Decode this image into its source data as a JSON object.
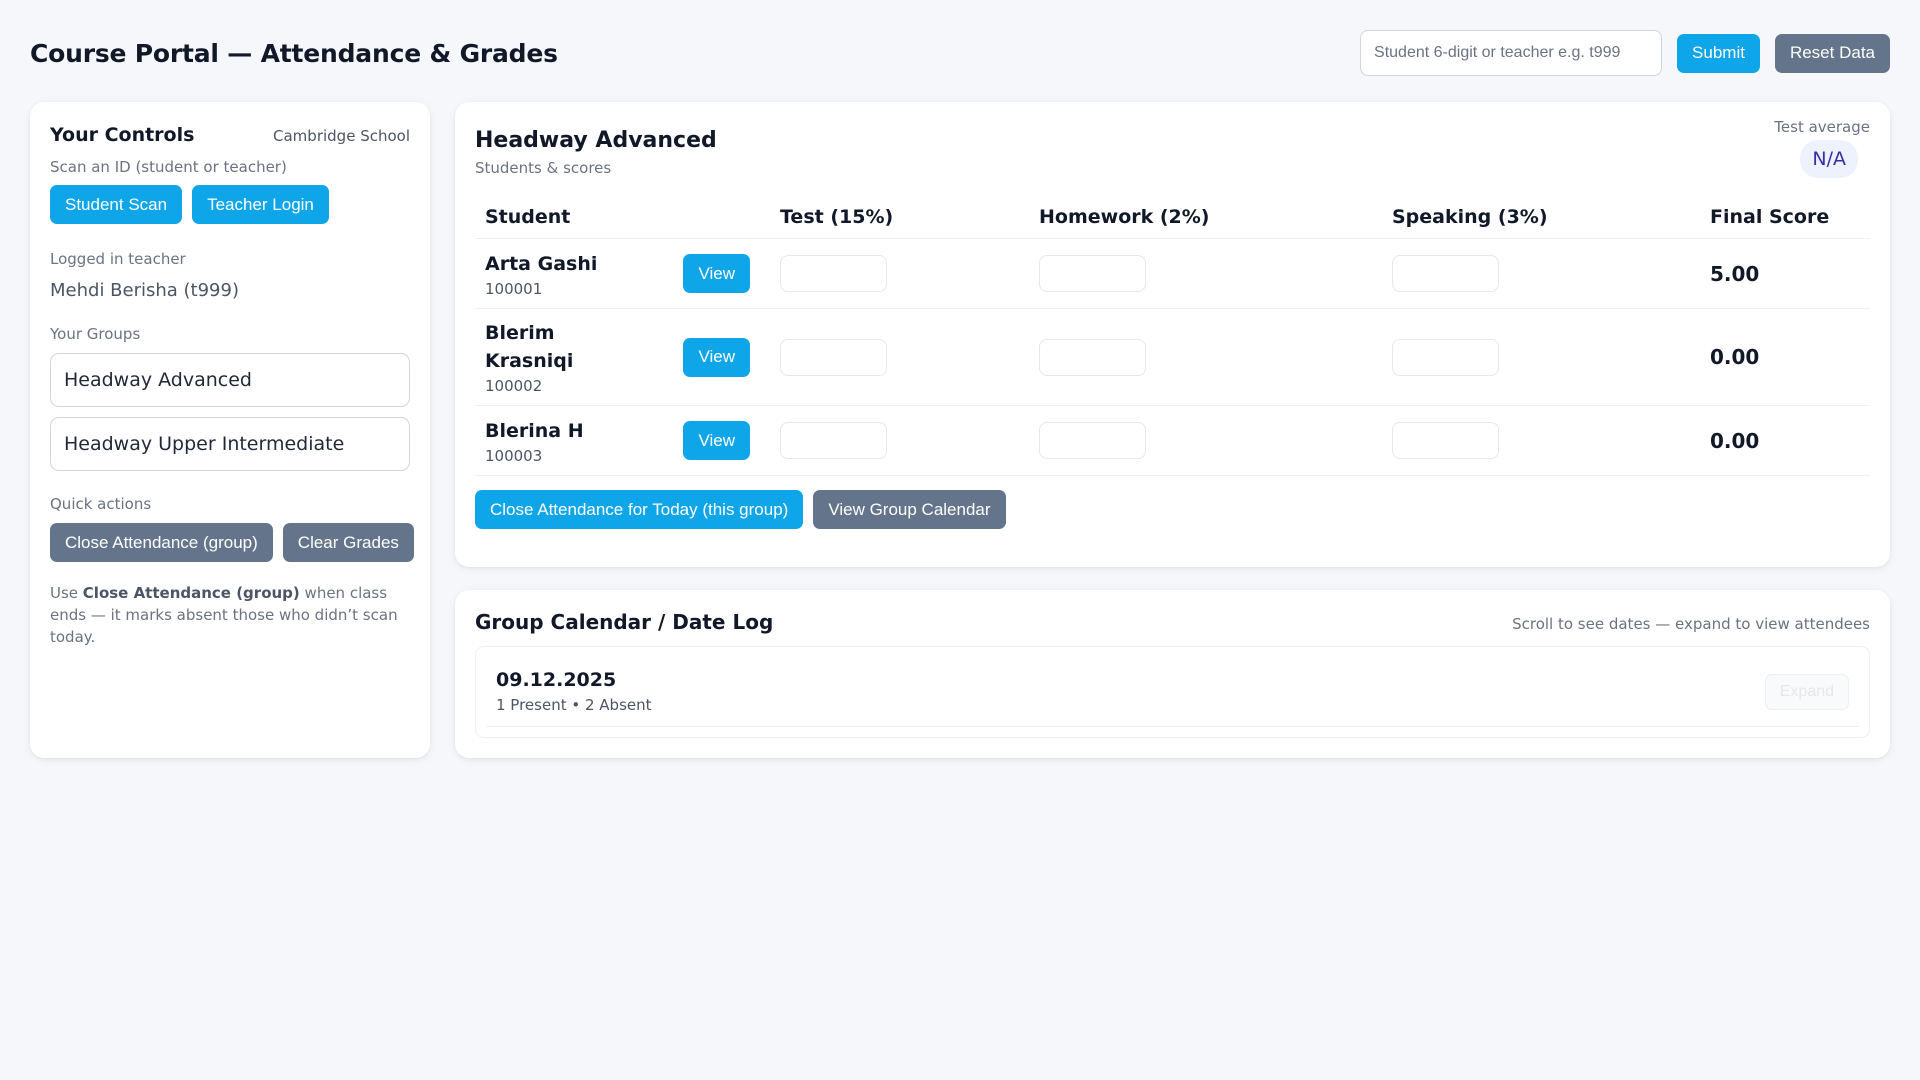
{
  "header": {
    "title": "Course Portal — Attendance & Grades",
    "id_input_placeholder": "Student 6-digit or teacher e.g. t999",
    "id_input_value": "",
    "submit_label": "Submit",
    "reset_label": "Reset Data"
  },
  "sidebar": {
    "title": "Your Controls",
    "school": "Cambridge School",
    "scan_label": "Scan an ID (student or teacher)",
    "student_scan_label": "Student Scan",
    "teacher_login_label": "Teacher Login",
    "logged_in_label": "Logged in teacher",
    "teacher_name": "Mehdi Berisha (t999)",
    "groups_label": "Your Groups",
    "groups": [
      {
        "name": "Headway Advanced"
      },
      {
        "name": "Headway Upper Intermediate"
      }
    ],
    "quick_actions_label": "Quick actions",
    "close_attendance_label": "Close Attendance (group)",
    "clear_grades_label": "Clear Grades",
    "help_prefix": "Use ",
    "help_bold": "Close Attendance (group)",
    "help_suffix": " when class ends — it marks absent those who didn’t scan today."
  },
  "main": {
    "group_title": "Headway Advanced",
    "subtitle": "Students & scores",
    "test_average_label": "Test average",
    "test_average_value": "N/A",
    "columns": [
      "Student",
      "Test (15%)",
      "Homework (2%)",
      "Speaking (3%)",
      "Final Score"
    ],
    "view_label": "View",
    "students": [
      {
        "name": "Arta Gashi",
        "id": "100001",
        "test": "",
        "homework": "",
        "speaking": "",
        "final": "5.00"
      },
      {
        "name": "Blerim Krasniqi",
        "id": "100002",
        "test": "",
        "homework": "",
        "speaking": "",
        "final": "0.00"
      },
      {
        "name": "Blerina H",
        "id": "100003",
        "test": "",
        "homework": "",
        "speaking": "",
        "final": "0.00"
      }
    ],
    "close_today_label": "Close Attendance for Today (this group)",
    "view_calendar_label": "View Group Calendar"
  },
  "calendar": {
    "title": "Group Calendar / Date Log",
    "hint": "Scroll to see dates — expand to view attendees",
    "entries": [
      {
        "date": "09.12.2025",
        "summary": "1 Present • 2 Absent",
        "expand_label": "Expand"
      }
    ]
  },
  "colors": {
    "accent": "#0ea5e9",
    "secondary_button": "#64748b",
    "page_background": "#f5f7fa",
    "average_pill_background": "#eef2ff",
    "average_pill_text": "#3730a3"
  }
}
